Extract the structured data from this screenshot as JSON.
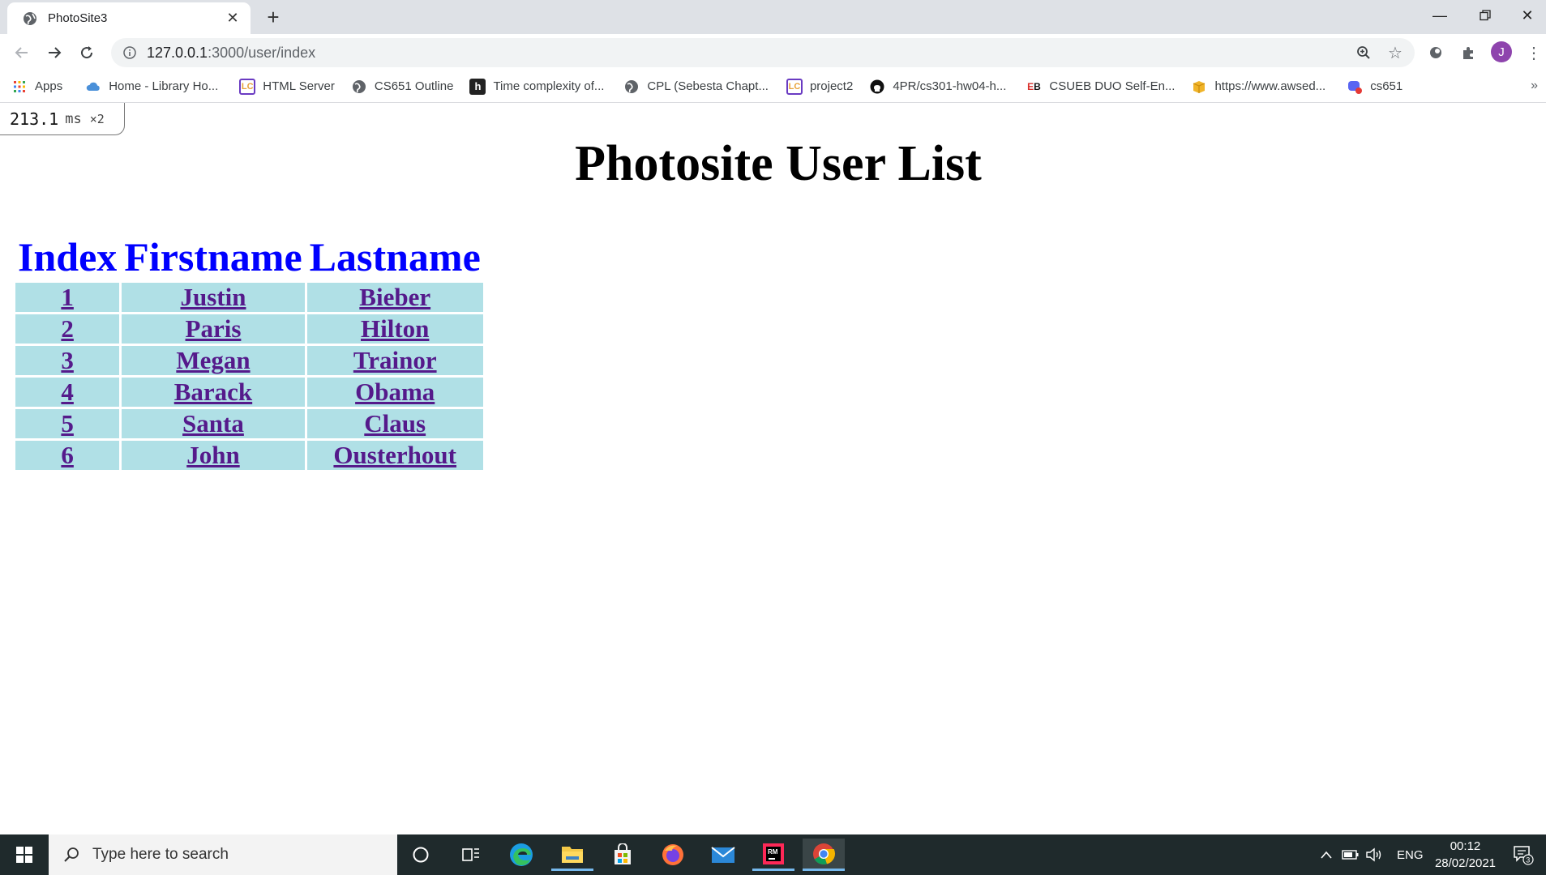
{
  "browser": {
    "tab_title": "PhotoSite3",
    "url_host": "127.0.0.1",
    "url_rest": ":3000/user/index",
    "avatar_letter": "J"
  },
  "bookmarks": [
    {
      "label": "Apps",
      "icon": "apps-grid-icon"
    },
    {
      "label": "Home - Library Ho...",
      "icon": "cloud-icon"
    },
    {
      "label": "HTML Server",
      "icon": "leetcode-icon"
    },
    {
      "label": "CS651 Outline",
      "icon": "globe-icon"
    },
    {
      "label": "Time complexity of...",
      "icon": "h-icon"
    },
    {
      "label": "CPL (Sebesta Chapt...",
      "icon": "globe-icon"
    },
    {
      "label": "project2",
      "icon": "leetcode-icon"
    },
    {
      "label": "4PR/cs301-hw04-h...",
      "icon": "github-icon"
    },
    {
      "label": "CSUEB DUO Self-En...",
      "icon": "eb-icon"
    },
    {
      "label": "https://www.awsed...",
      "icon": "box-icon"
    },
    {
      "label": "cs651",
      "icon": "discord-icon"
    }
  ],
  "timing": {
    "value": "213.1",
    "unit": "ms",
    "multiplier": "×2"
  },
  "page": {
    "title": "Photosite User List",
    "headers": [
      "Index",
      "Firstname",
      "Lastname"
    ],
    "rows": [
      {
        "index": "1",
        "first": "Justin",
        "last": "Bieber"
      },
      {
        "index": "2",
        "first": "Paris",
        "last": "Hilton"
      },
      {
        "index": "3",
        "first": "Megan",
        "last": "Trainor"
      },
      {
        "index": "4",
        "first": "Barack",
        "last": "Obama"
      },
      {
        "index": "5",
        "first": "Santa",
        "last": "Claus"
      },
      {
        "index": "6",
        "first": "John",
        "last": "Ousterhout"
      }
    ]
  },
  "taskbar": {
    "search_placeholder": "Type here to search",
    "language": "ENG",
    "time": "00:12",
    "date": "28/02/2021",
    "notification_count": "3"
  },
  "colors": {
    "header_text": "#0000ff",
    "cell_bg": "#b0e0e6",
    "link": "#551a8b"
  }
}
